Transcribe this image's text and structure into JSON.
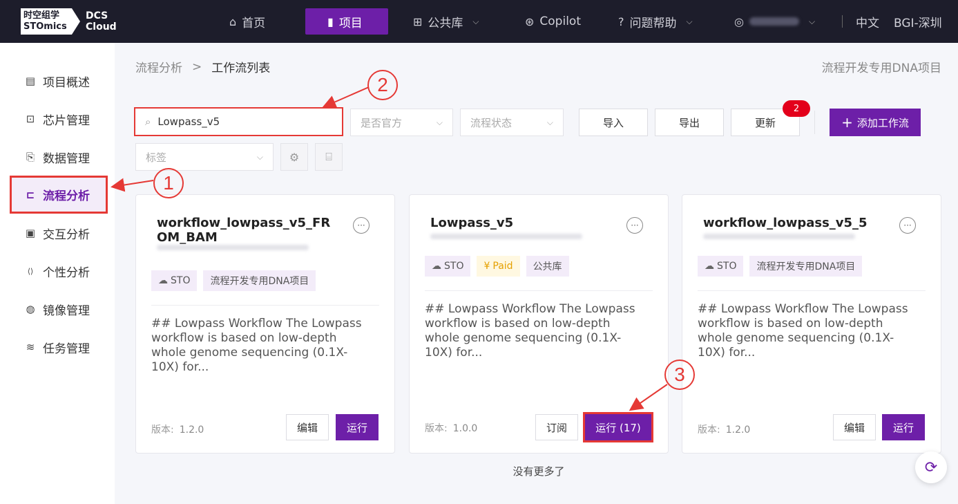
{
  "header": {
    "logo_line1": "时空组学",
    "logo_line2": "STOmics",
    "logo_product1": "DCS",
    "logo_product2": "Cloud",
    "nav": [
      {
        "label": "首页",
        "icon": "home-icon",
        "glyph": "⌂"
      },
      {
        "label": "项目",
        "icon": "document-icon",
        "glyph": "▮",
        "active": true
      },
      {
        "label": "公共库",
        "icon": "grid-icon",
        "glyph": "⊞",
        "has_dropdown": true
      },
      {
        "label": "Copilot",
        "icon": "copilot-icon",
        "glyph": "⊛"
      },
      {
        "label": "问题帮助",
        "icon": "help-icon",
        "glyph": "?",
        "has_dropdown": true
      }
    ],
    "user_icon": "user-icon",
    "language": "中文",
    "region": "BGI-深圳"
  },
  "sidebar": {
    "items": [
      {
        "label": "项目概述",
        "icon": "file-icon",
        "glyph": "▤"
      },
      {
        "label": "芯片管理",
        "icon": "chip-icon",
        "glyph": "⊡"
      },
      {
        "label": "数据管理",
        "icon": "data-icon",
        "glyph": "⎘"
      },
      {
        "label": "流程分析",
        "icon": "workflow-icon",
        "glyph": "⊏",
        "active": true
      },
      {
        "label": "交互分析",
        "icon": "interactive-icon",
        "glyph": "▣"
      },
      {
        "label": "个性分析",
        "icon": "code-icon",
        "glyph": "⟨⟩"
      },
      {
        "label": "镜像管理",
        "icon": "docker-icon",
        "glyph": "◍"
      },
      {
        "label": "任务管理",
        "icon": "layers-icon",
        "glyph": "≋"
      }
    ]
  },
  "breadcrumb": {
    "parent": "流程分析",
    "separator": ">",
    "current": "工作流列表"
  },
  "project_name": "流程开发专用DNA项目",
  "filters": {
    "search_value": "Lowpass_v5",
    "official_placeholder": "是否官方",
    "status_placeholder": "流程状态",
    "tag_placeholder": "标签"
  },
  "toolbar": {
    "import_label": "导入",
    "export_label": "导出",
    "update_label": "更新",
    "update_badge": "2",
    "add_label": "添加工作流",
    "add_glyph": "+"
  },
  "cards": [
    {
      "title": "workflow_lowpass_v5_FROM_BAM",
      "tags": [
        {
          "label": "STO",
          "icon": "cloud-icon",
          "glyph": "☁"
        },
        {
          "label": "流程开发专用DNA项目"
        }
      ],
      "description": "## Lowpass Workflow The Lowpass workflow is based on low-depth whole genome sequencing (0.1X-10X) for...",
      "version_label": "版本:",
      "version": "1.2.0",
      "secondary_button": "编辑",
      "primary_button": "运行"
    },
    {
      "title": "Lowpass_v5",
      "tags": [
        {
          "label": "STO",
          "icon": "cloud-icon",
          "glyph": "☁"
        },
        {
          "label": "Paid",
          "icon": "yuan-icon",
          "glyph": "¥"
        },
        {
          "label": "公共库"
        }
      ],
      "description": "## Lowpass Workflow The Lowpass workflow is based on low-depth whole genome sequencing (0.1X-10X) for...",
      "version_label": "版本:",
      "version": "1.0.0",
      "secondary_button": "订阅",
      "primary_button": "运行 (17)"
    },
    {
      "title": "workflow_lowpass_v5_5",
      "tags": [
        {
          "label": "STO",
          "icon": "cloud-icon",
          "glyph": "☁"
        },
        {
          "label": "流程开发专用DNA项目"
        }
      ],
      "description": "## Lowpass Workflow The Lowpass workflow is based on low-depth whole genome sequencing (0.1X-10X) for...",
      "version_label": "版本:",
      "version": "1.2.0",
      "secondary_button": "编辑",
      "primary_button": "运行"
    }
  ],
  "footer_text": "没有更多了",
  "annotations": {
    "step1": "1",
    "step2": "2",
    "step3": "3"
  },
  "colors": {
    "brand": "#6d1fa8",
    "annotation": "#e53935",
    "badge": "#e3001b",
    "topbar": "#1d1d2b"
  }
}
